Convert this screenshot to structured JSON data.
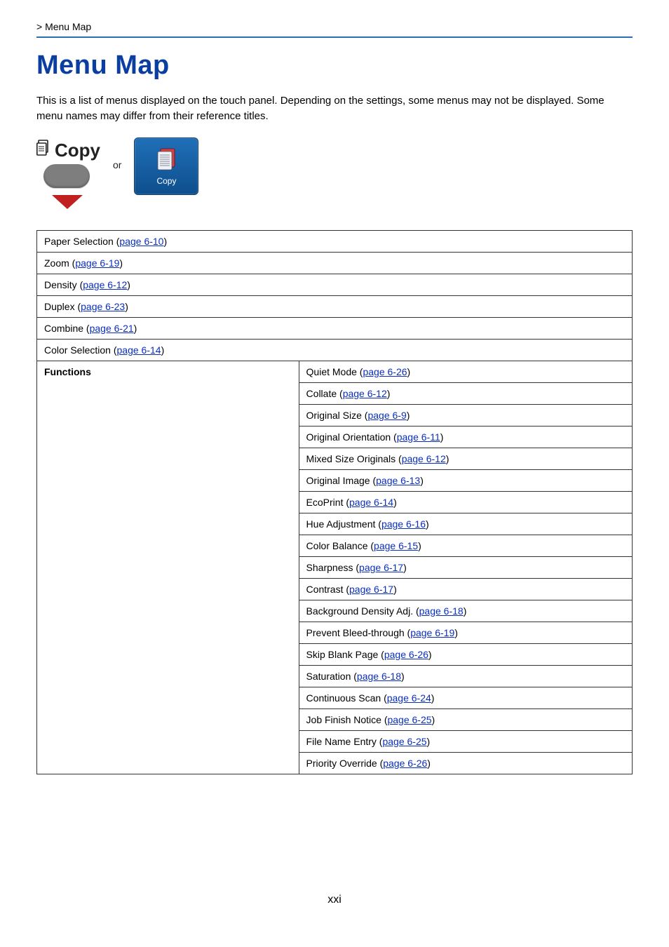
{
  "breadcrumb": " > Menu Map",
  "title": "Menu Map",
  "intro": "This is a list of menus displayed on the touch panel. Depending on the settings, some menus may not be displayed. Some menu names may differ from their reference titles.",
  "copy_hardkey_label": "Copy",
  "or_label": "or",
  "copy_softkey_label": "Copy",
  "simple_rows": [
    {
      "label": "Paper Selection",
      "link": "page 6-10"
    },
    {
      "label": "Zoom",
      "link": "page 6-19"
    },
    {
      "label": "Density",
      "link": "page 6-12"
    },
    {
      "label": "Duplex",
      "link": "page 6-23"
    },
    {
      "label": "Combine",
      "link": "page 6-21"
    },
    {
      "label": "Color Selection",
      "link": "page 6-14"
    }
  ],
  "functions_label": "Functions",
  "functions_rows": [
    {
      "label": "Quiet Mode",
      "link": "page 6-26"
    },
    {
      "label": "Collate",
      "link": "page 6-12"
    },
    {
      "label": "Original Size",
      "link": "page 6-9"
    },
    {
      "label": "Original Orientation",
      "link": "page 6-11"
    },
    {
      "label": "Mixed Size Originals",
      "link": "page 6-12"
    },
    {
      "label": "Original Image",
      "link": "page 6-13"
    },
    {
      "label": "EcoPrint",
      "link": "page 6-14"
    },
    {
      "label": "Hue Adjustment",
      "link": "page 6-16"
    },
    {
      "label": "Color Balance",
      "link": "page 6-15"
    },
    {
      "label": "Sharpness",
      "link": "page 6-17"
    },
    {
      "label": "Contrast",
      "link": "page 6-17"
    },
    {
      "label": "Background Density Adj.",
      "link": "page 6-18"
    },
    {
      "label": "Prevent Bleed-through",
      "link": "page 6-19"
    },
    {
      "label": "Skip Blank Page",
      "link": "page 6-26"
    },
    {
      "label": "Saturation",
      "link": "page 6-18"
    },
    {
      "label": "Continuous Scan",
      "link": "page 6-24"
    },
    {
      "label": "Job Finish Notice",
      "link": "page 6-25"
    },
    {
      "label": "File Name Entry",
      "link": "page 6-25"
    },
    {
      "label": "Priority Override",
      "link": "page 6-26"
    }
  ],
  "page_number": "xxi"
}
